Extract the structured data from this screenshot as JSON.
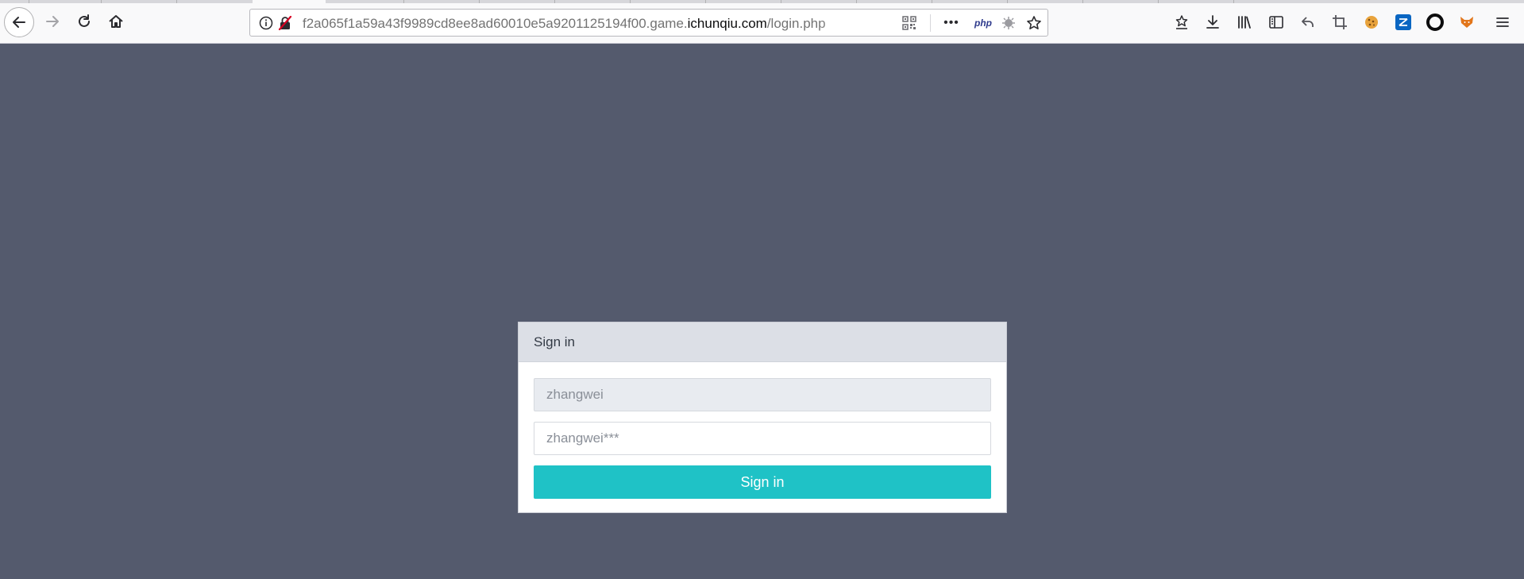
{
  "browser": {
    "url_prefix": "f2a065f1a59a43f9989cd8ee8ad60010e5a9201125194f00.game.",
    "url_host": "ichunqiu.com",
    "url_path": "/login.php",
    "php_label": "php",
    "accent_color": "#1fc2c6",
    "page_background": "#545a6d"
  },
  "login": {
    "header_title": "Sign in",
    "username_placeholder": "zhangwei",
    "password_placeholder": "zhangwei***",
    "submit_label": "Sign in"
  }
}
